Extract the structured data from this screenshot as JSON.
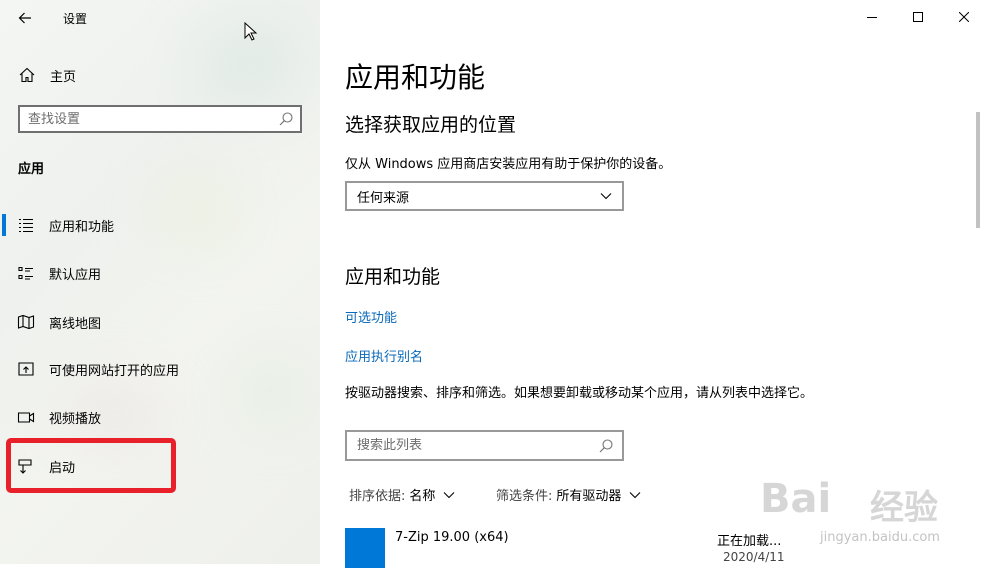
{
  "window": {
    "title": "设置"
  },
  "sidebar": {
    "home_label": "主页",
    "search_placeholder": "查找设置",
    "section_label": "应用",
    "items": [
      {
        "label": "应用和功能",
        "icon": "list-icon",
        "selected": true
      },
      {
        "label": "默认应用",
        "icon": "default-apps-icon",
        "selected": false
      },
      {
        "label": "离线地图",
        "icon": "map-icon",
        "selected": false
      },
      {
        "label": "可使用网站打开的应用",
        "icon": "website-app-icon",
        "selected": false
      },
      {
        "label": "视频播放",
        "icon": "video-icon",
        "selected": false
      },
      {
        "label": "启动",
        "icon": "startup-icon",
        "selected": false
      }
    ]
  },
  "main": {
    "page_title": "应用和功能",
    "install_section": {
      "heading": "选择获取应用的位置",
      "description": "仅从 Windows 应用商店安装应用有助于保护你的设备。",
      "dropdown_value": "任何来源"
    },
    "apps_section": {
      "heading": "应用和功能",
      "link_optional": "可选功能",
      "link_alias": "应用执行别名",
      "paragraph": "按驱动器搜索、排序和筛选。如果想要卸载或移动某个应用，请从列表中选择它。",
      "search_placeholder": "搜索此列表",
      "sort_key": "排序依据:",
      "sort_value": "名称",
      "filter_key": "筛选条件:",
      "filter_value": "所有驱动器",
      "apps": [
        {
          "name": "7-Zip 19.00 (x64)",
          "status": "正在加载...",
          "date": "2020/4/11"
        }
      ]
    }
  },
  "watermark": {
    "logo": "Bai",
    "cn": "经验",
    "url": "jingyan.baidu.com"
  },
  "colors": {
    "accent": "#0078d7",
    "link": "#0a69b8",
    "highlight": "#e8202a"
  }
}
